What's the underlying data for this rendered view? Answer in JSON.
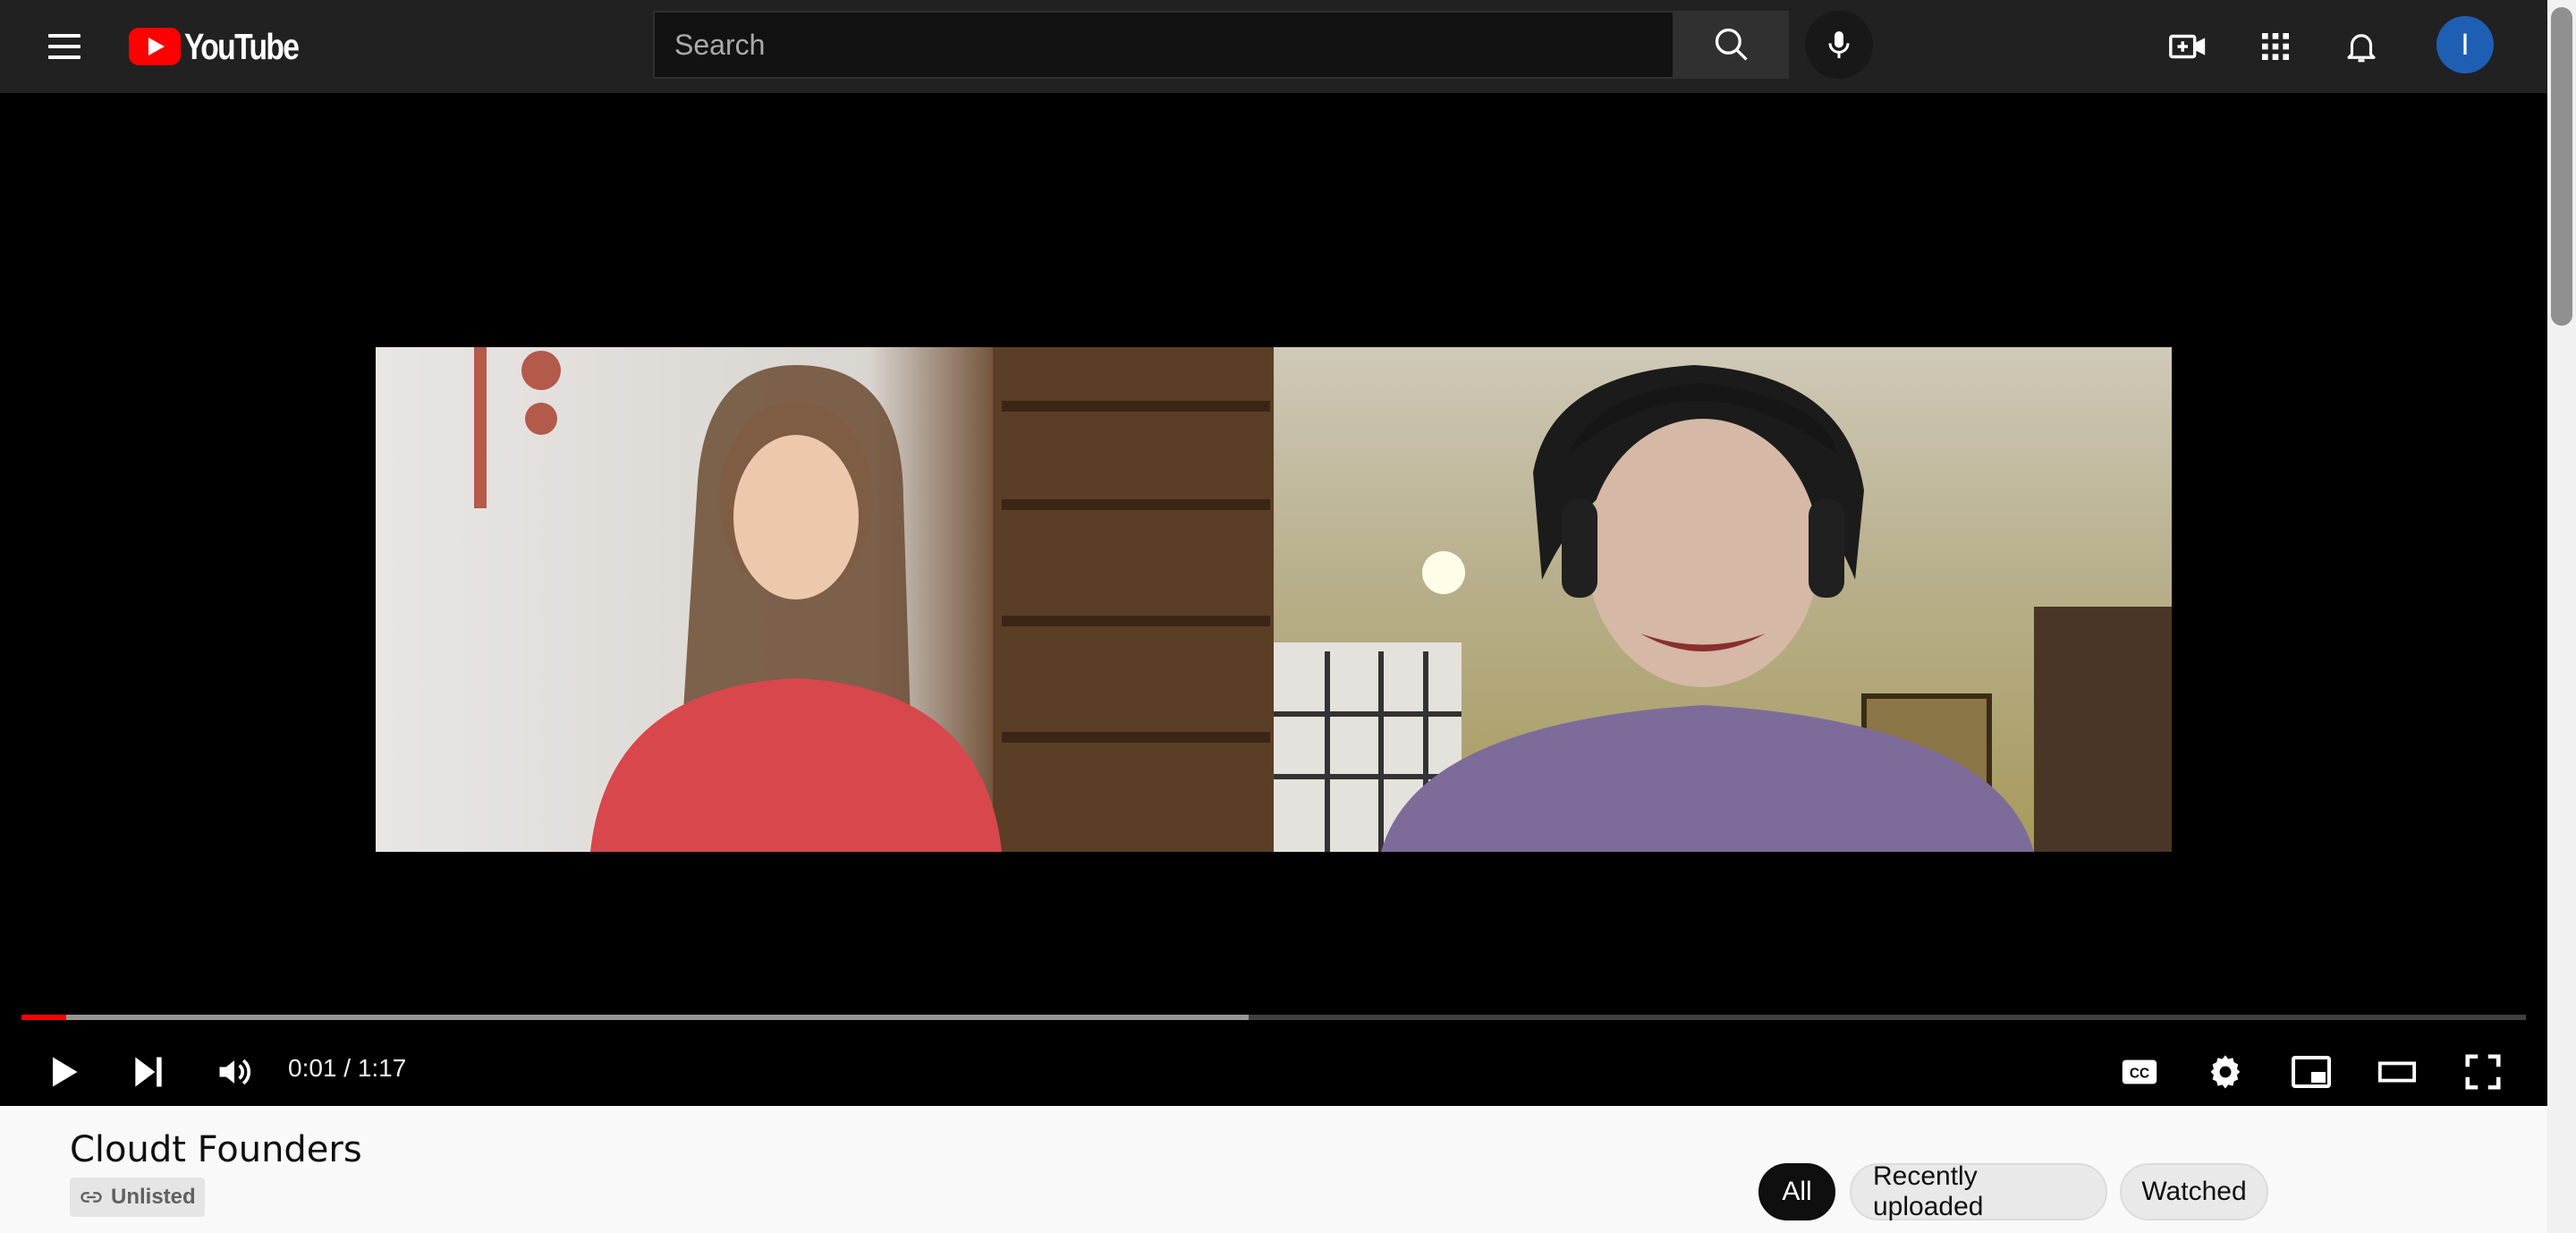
{
  "header": {
    "logo_text": "YouTube",
    "search_placeholder": "Search",
    "avatar_initial": "I"
  },
  "player": {
    "time_display": "0:01 / 1:17",
    "progress_played_fraction": 0.018,
    "progress_buffered_fraction": 0.49
  },
  "video": {
    "title": "Cloudt Founders",
    "visibility_label": "Unlisted"
  },
  "chips": [
    {
      "label": "All",
      "active": true
    },
    {
      "label": "Recently uploaded",
      "active": false
    },
    {
      "label": "Watched",
      "active": false
    }
  ],
  "colors": {
    "accent": "#ff0000",
    "topbar_bg": "#212121",
    "avatar_bg": "#1e5fb3"
  },
  "icons": [
    "menu-icon",
    "youtube-logo-icon",
    "search-icon",
    "mic-icon",
    "create-video-icon",
    "apps-icon",
    "notifications-icon",
    "play-icon",
    "next-icon",
    "volume-icon",
    "captions-icon",
    "settings-icon",
    "miniplayer-icon",
    "theater-mode-icon",
    "fullscreen-icon",
    "link-icon"
  ]
}
